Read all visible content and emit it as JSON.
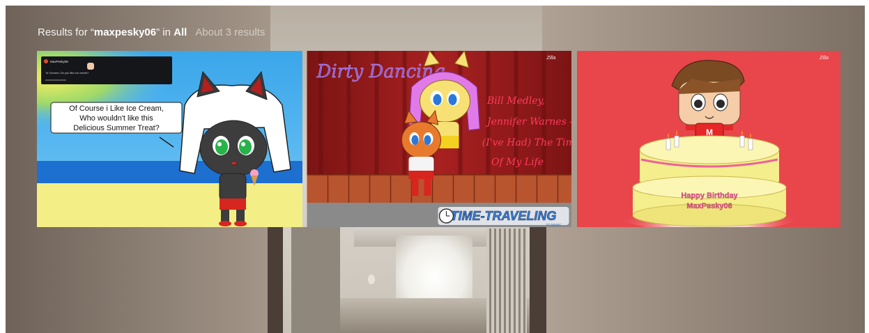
{
  "search": {
    "prefix": "Results for “",
    "query": "maxpesky06",
    "middle": "” in ",
    "scope": "All",
    "count_text": "About 3 results"
  },
  "results": [
    {
      "speech_bubble_lines": [
        "Of Course i Like Ice Cream,",
        "Who wouldn't like this",
        "Delicious Summer Treat?"
      ],
      "inset_username": "MaxPesky06",
      "inset_comment": "To Chrome: Do you like ice cream?"
    },
    {
      "title_text": "Dirty Dancing",
      "song_lines": [
        "Bill Medley,",
        "Jennifer Warnes -",
        "(I've Had) The Time",
        "Of My Life"
      ],
      "badge_text": "TIME-TRAVELING",
      "badge_subtext": "TO MUSIC",
      "watermark": "Zilla"
    },
    {
      "banner_lines": [
        "Happy Birthday",
        "MaxPesky06"
      ],
      "shirt_letter": "M",
      "watermark": "Zilla"
    }
  ],
  "colors": {
    "thumb1_sky": "#2fa0e8",
    "thumb2_curtain": "#9c1d1d",
    "thumb3_bg": "#e8464b",
    "cake": "#f5ee8c"
  }
}
